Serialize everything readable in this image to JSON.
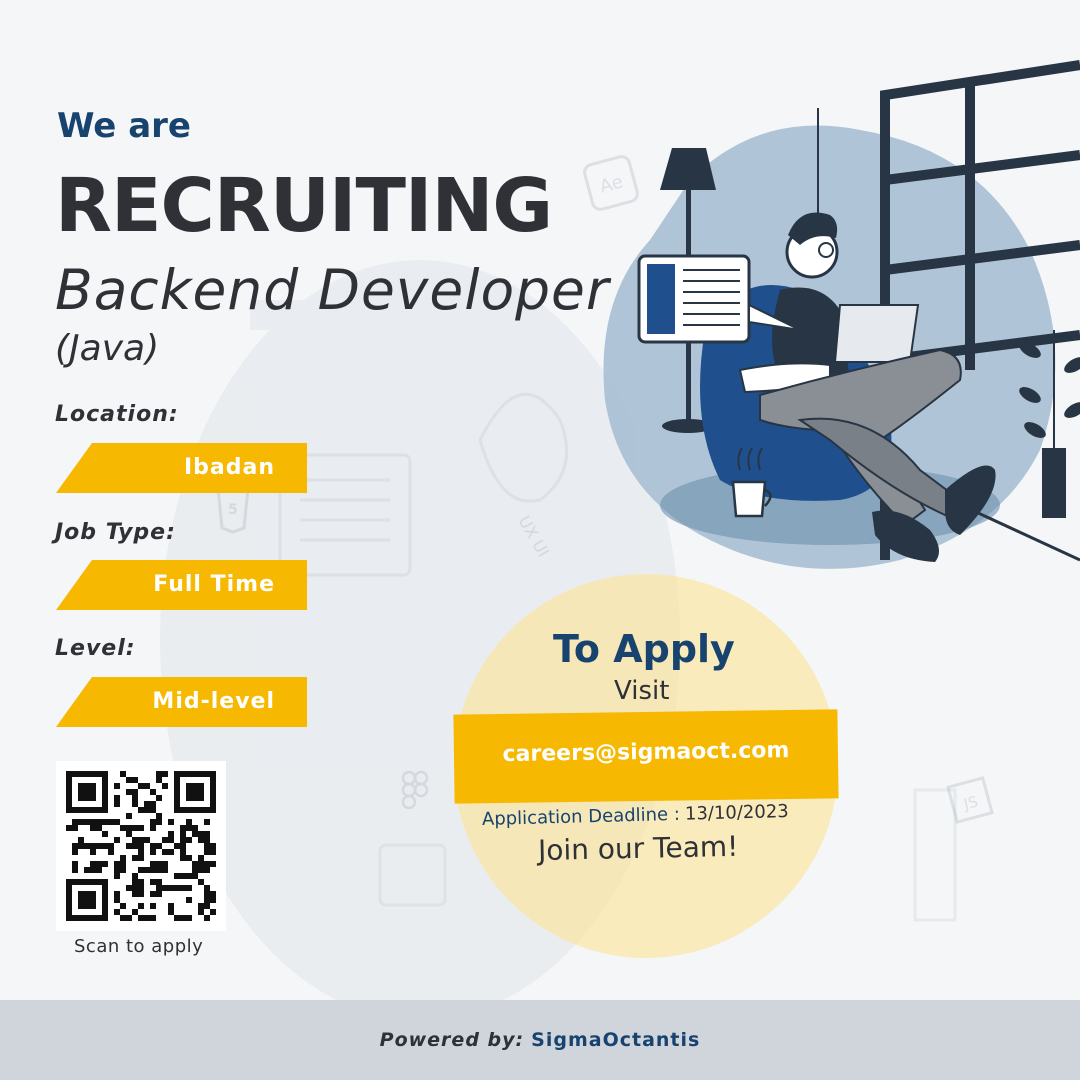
{
  "headline": {
    "intro": "We are",
    "main": "RECRUITING",
    "role": "Backend Developer",
    "role_detail": "(Java)"
  },
  "fields": [
    {
      "label": "Location:",
      "value": "Ibadan"
    },
    {
      "label": "Job Type:",
      "value": "Full Time"
    },
    {
      "label": "Level:",
      "value": "Mid-level"
    }
  ],
  "qr": {
    "caption": "Scan to apply"
  },
  "apply": {
    "title": "To Apply",
    "visit": "Visit",
    "email": "careers@sigmaoct.com",
    "deadline_label": "Application Deadline :",
    "deadline_value": "13/10/2023",
    "cta": "Join our Team!"
  },
  "footer": {
    "label": "Powered by:",
    "brand": "SigmaOctantis"
  },
  "colors": {
    "primary_blue": "#17436e",
    "accent_yellow": "#f6b800",
    "text_dark": "#2f3136",
    "background": "#f4f6f8",
    "footer_bg": "#d0d5db"
  },
  "icons": [
    "html5-icon",
    "ux-ui-icon",
    "after-effects-icon",
    "figma-icon",
    "javascript-icon",
    "floor-lamp-icon",
    "window-icon",
    "plant-icon",
    "coffee-mug-icon",
    "laptop-icon"
  ]
}
